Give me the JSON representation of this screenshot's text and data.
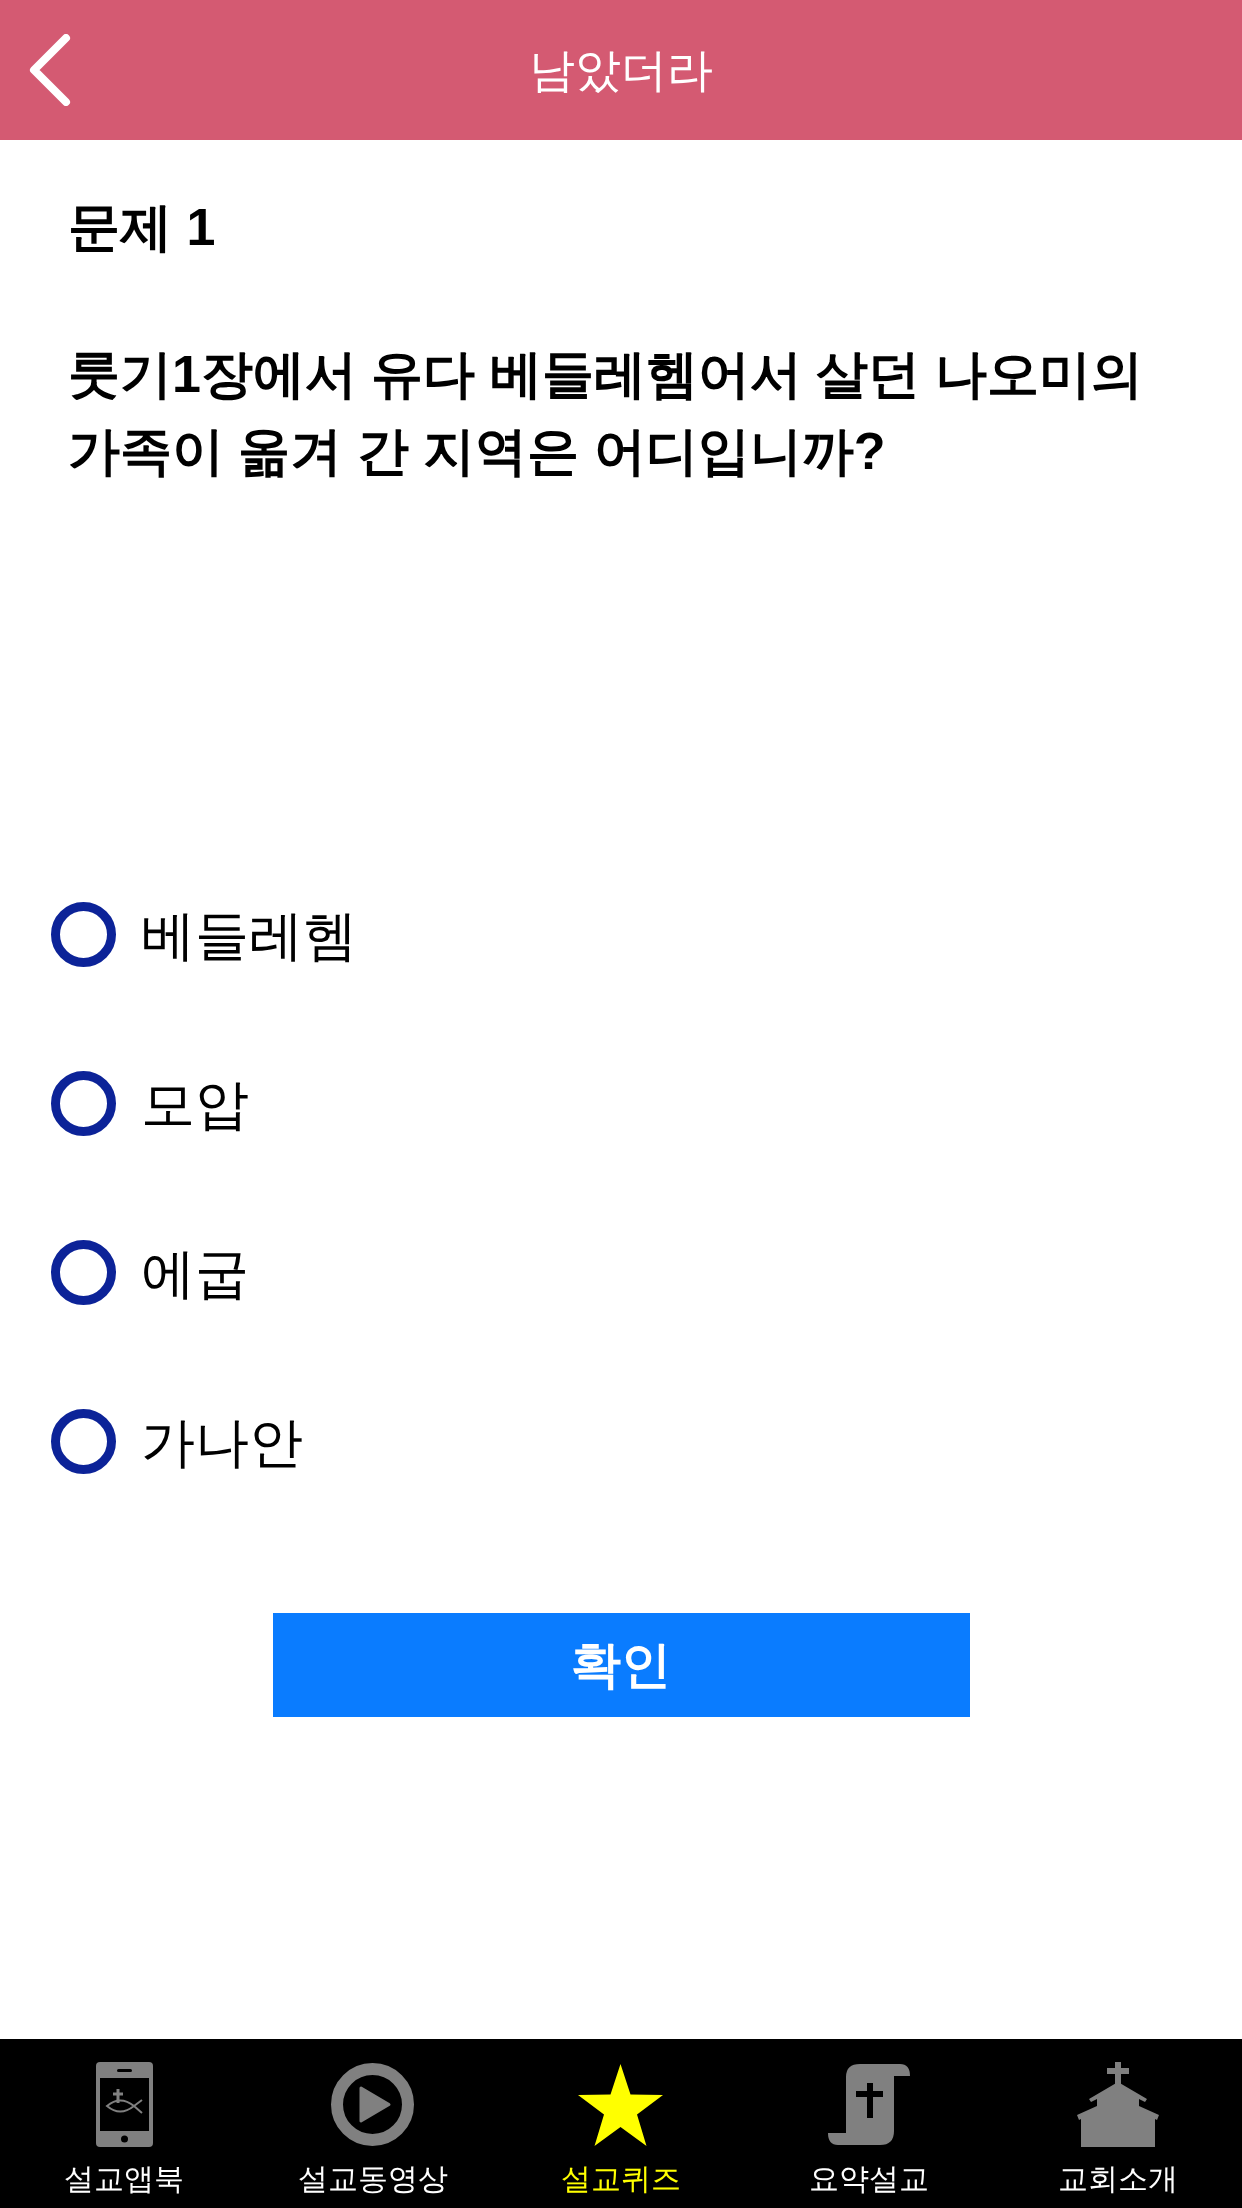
{
  "header": {
    "title": "남았더라"
  },
  "question": {
    "number": "문제 1",
    "text": "룻기1장에서 유다 베들레헴어서 살던 나오미의 가족이 옮겨 간 지역은 어디입니까?"
  },
  "options": [
    {
      "label": "베들레헴",
      "selected": false
    },
    {
      "label": "모압",
      "selected": false
    },
    {
      "label": "에굽",
      "selected": false
    },
    {
      "label": "가나안",
      "selected": false
    }
  ],
  "confirm_button": {
    "label": "확인"
  },
  "tab_bar": {
    "items": [
      {
        "label": "설교앱북",
        "selected": false
      },
      {
        "label": "설교동영상",
        "selected": false
      },
      {
        "label": "설교퀴즈",
        "selected": true
      },
      {
        "label": "요약설교",
        "selected": false
      },
      {
        "label": "교회소개",
        "selected": false
      }
    ]
  }
}
